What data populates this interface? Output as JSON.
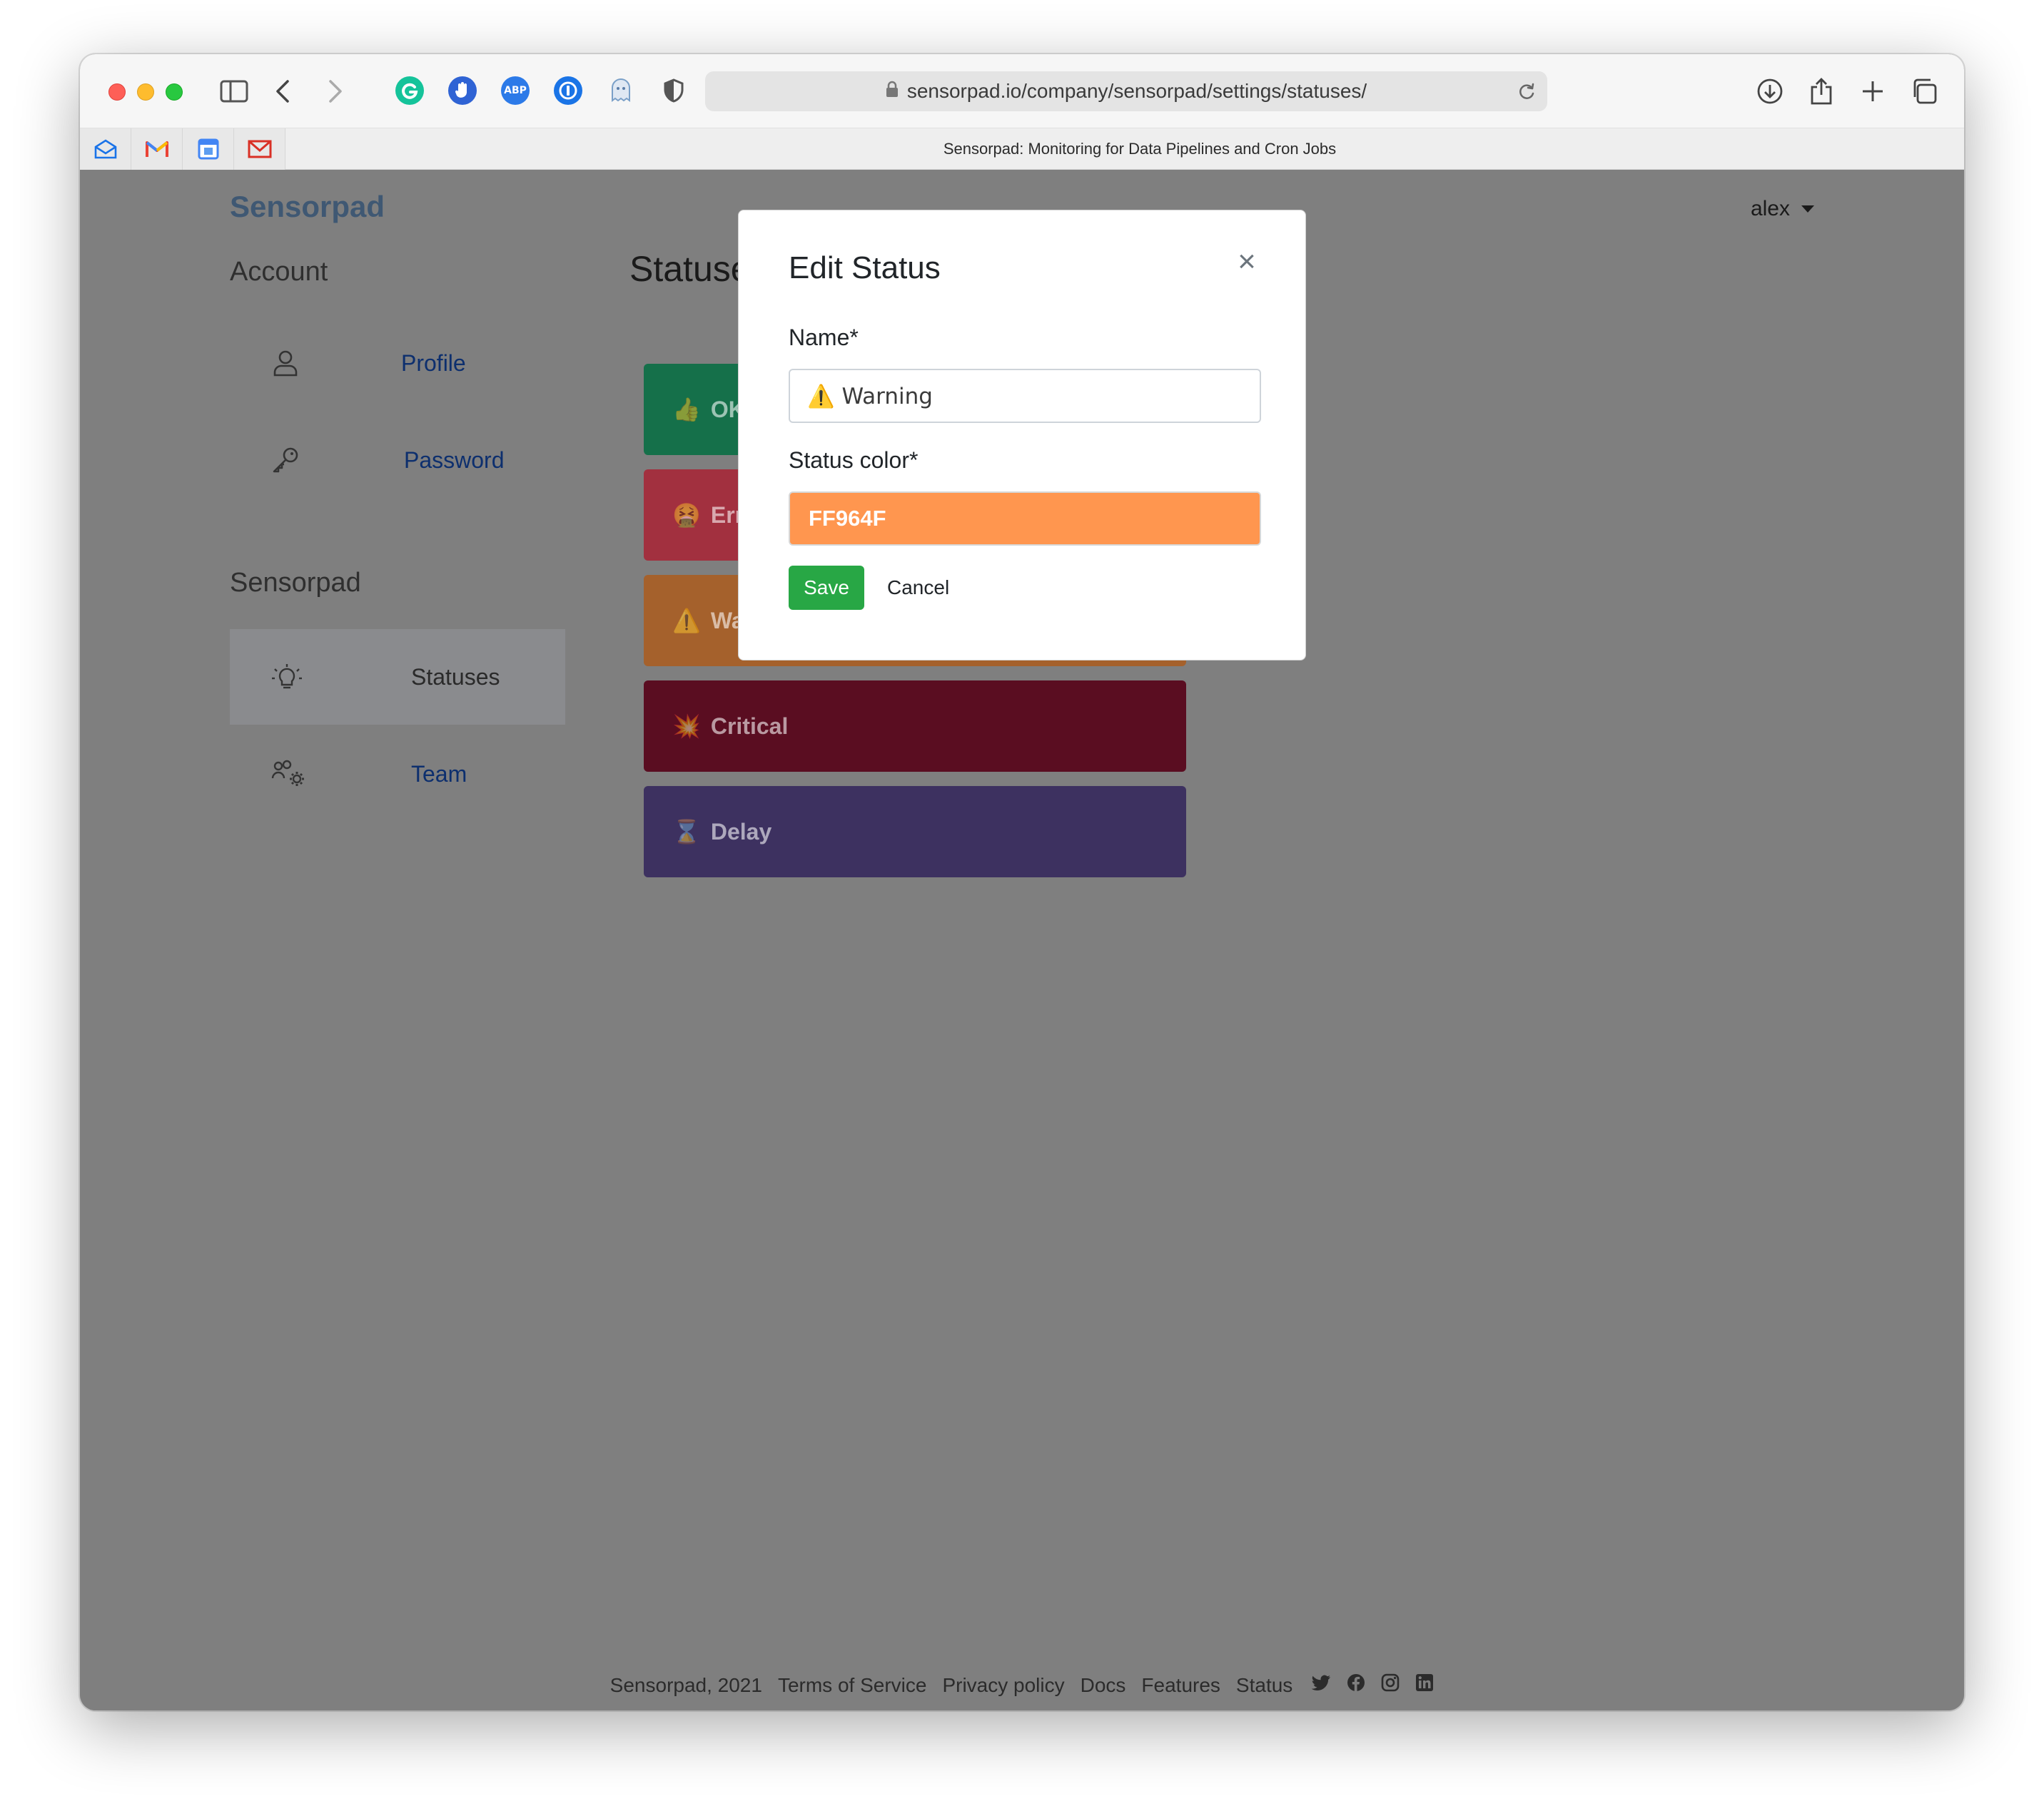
{
  "browser": {
    "url": "sensorpad.io/company/sensorpad/settings/statuses/",
    "tab_title": "Sensorpad: Monitoring for Data Pipelines and Cron Jobs",
    "extensions": [
      "grammarly-icon",
      "hand-icon",
      "adblock-plus-icon",
      "1password-icon",
      "ghostery-icon",
      "shield-icon"
    ],
    "abp_label": "ABP"
  },
  "header": {
    "brand": "Sensorpad",
    "user": "alex"
  },
  "sidebar": {
    "account_heading": "Account",
    "account_items": [
      {
        "label": "Profile",
        "icon": "user-icon"
      },
      {
        "label": "Password",
        "icon": "key-icon"
      }
    ],
    "sensorpad_heading": "Sensorpad",
    "sensorpad_items": [
      {
        "label": "Statuses",
        "icon": "lightbulb-icon",
        "active": true
      },
      {
        "label": "Team",
        "icon": "team-settings-icon",
        "active": false
      }
    ]
  },
  "main": {
    "heading": "Statuse",
    "statuses": [
      {
        "emoji": "👍",
        "label": "OK",
        "color": "#15704a"
      },
      {
        "emoji": "🤮",
        "label": "Err",
        "color": "#a2303f"
      },
      {
        "emoji": "⚠️",
        "label": "Wa",
        "color": "#a5612c"
      },
      {
        "emoji": "💥",
        "label": "Critical",
        "color": "#5a0d21"
      },
      {
        "emoji": "⌛",
        "label": "Delay",
        "color": "#3d3160"
      }
    ]
  },
  "modal": {
    "title": "Edit Status",
    "close": "×",
    "name_label": "Name*",
    "name_value": "⚠️ Warning",
    "color_label": "Status color*",
    "color_value": "FF964F",
    "save_label": "Save",
    "cancel_label": "Cancel"
  },
  "footer": {
    "copyright": "Sensorpad, 2021",
    "links": [
      "Terms of Service",
      "Privacy policy",
      "Docs",
      "Features",
      "Status"
    ],
    "social": [
      "twitter-icon",
      "facebook-icon",
      "instagram-icon",
      "linkedin-icon"
    ]
  }
}
